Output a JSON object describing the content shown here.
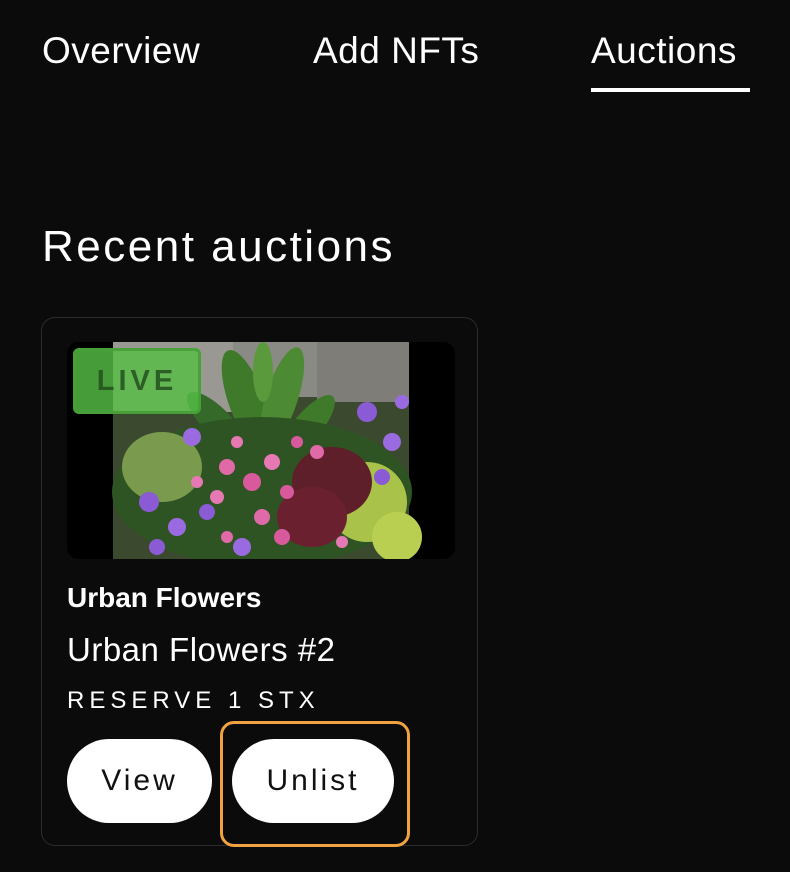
{
  "tabs": {
    "overview": "Overview",
    "add_nfts": "Add NFTs",
    "auctions": "Auctions",
    "active": "Auctions"
  },
  "section": {
    "title": "Recent auctions"
  },
  "auction_card": {
    "badge": "LIVE",
    "collection": "Urban Flowers",
    "item_name": "Urban Flowers #2",
    "reserve": "RESERVE 1 STX",
    "view_label": "View",
    "unlist_label": "Unlist",
    "image_subject": "flower planter with pink and purple petunias"
  },
  "colors": {
    "background": "#0b0b0b",
    "text": "#ffffff",
    "badge": "#56be46",
    "focus_ring": "#f0a140"
  }
}
